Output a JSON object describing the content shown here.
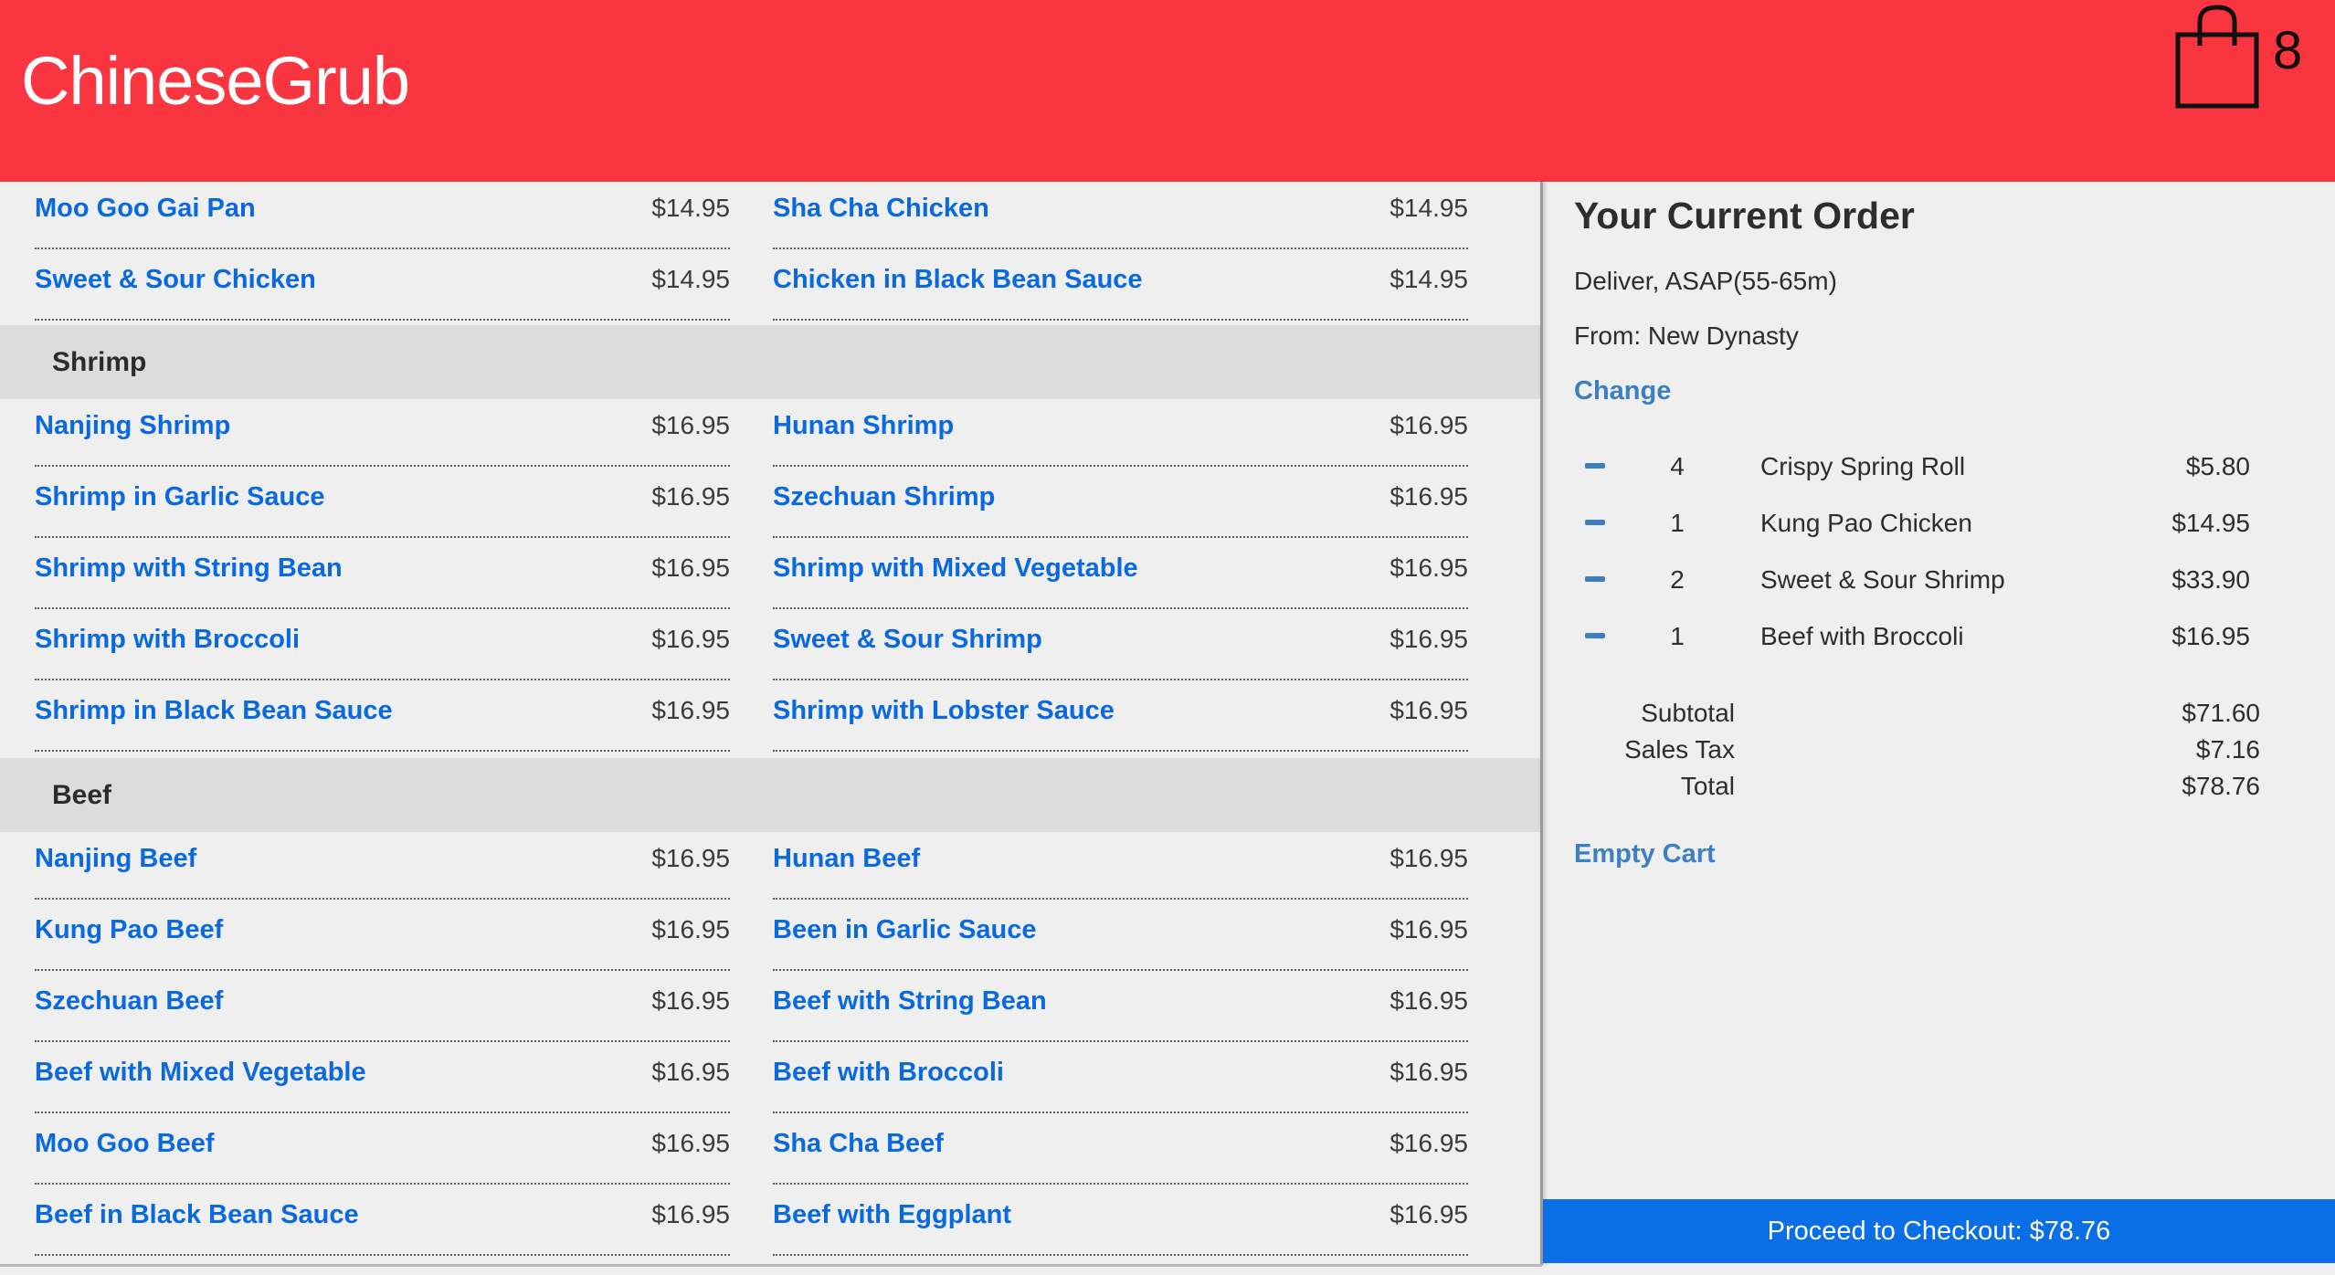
{
  "header": {
    "brand": "ChineseGrub",
    "cart_count": "8",
    "bg_color": "#f93540"
  },
  "menu": {
    "top_rows": [
      {
        "left": {
          "name": "Moo Goo Gai Pan",
          "price": "$14.95"
        },
        "right": {
          "name": "Sha Cha Chicken",
          "price": "$14.95"
        }
      },
      {
        "left": {
          "name": "Sweet & Sour Chicken",
          "price": "$14.95"
        },
        "right": {
          "name": "Chicken in Black Bean Sauce",
          "price": "$14.95"
        }
      }
    ],
    "categories": [
      {
        "label": "Shrimp",
        "rows": [
          {
            "left": {
              "name": "Nanjing Shrimp",
              "price": "$16.95"
            },
            "right": {
              "name": "Hunan Shrimp",
              "price": "$16.95"
            }
          },
          {
            "left": {
              "name": "Shrimp in Garlic Sauce",
              "price": "$16.95"
            },
            "right": {
              "name": "Szechuan Shrimp",
              "price": "$16.95"
            }
          },
          {
            "left": {
              "name": "Shrimp with String Bean",
              "price": "$16.95"
            },
            "right": {
              "name": "Shrimp with Mixed Vegetable",
              "price": "$16.95"
            }
          },
          {
            "left": {
              "name": "Shrimp with Broccoli",
              "price": "$16.95"
            },
            "right": {
              "name": "Sweet & Sour Shrimp",
              "price": "$16.95"
            }
          },
          {
            "left": {
              "name": "Shrimp in Black Bean Sauce",
              "price": "$16.95"
            },
            "right": {
              "name": "Shrimp with Lobster Sauce",
              "price": "$16.95"
            }
          }
        ]
      },
      {
        "label": "Beef",
        "rows": [
          {
            "left": {
              "name": "Nanjing Beef",
              "price": "$16.95"
            },
            "right": {
              "name": "Hunan Beef",
              "price": "$16.95"
            }
          },
          {
            "left": {
              "name": "Kung Pao Beef",
              "price": "$16.95"
            },
            "right": {
              "name": "Been in Garlic Sauce",
              "price": "$16.95"
            }
          },
          {
            "left": {
              "name": "Szechuan Beef",
              "price": "$16.95"
            },
            "right": {
              "name": "Beef with String Bean",
              "price": "$16.95"
            }
          },
          {
            "left": {
              "name": "Beef with Mixed Vegetable",
              "price": "$16.95"
            },
            "right": {
              "name": "Beef with Broccoli",
              "price": "$16.95"
            }
          },
          {
            "left": {
              "name": "Moo Goo Beef",
              "price": "$16.95"
            },
            "right": {
              "name": "Sha Cha Beef",
              "price": "$16.95"
            }
          },
          {
            "left": {
              "name": "Beef in Black Bean Sauce",
              "price": "$16.95"
            },
            "right": {
              "name": "Beef with Eggplant",
              "price": "$16.95"
            }
          }
        ]
      }
    ]
  },
  "order": {
    "title": "Your Current Order",
    "delivery": "Deliver, ASAP(55-65m)",
    "from": "From: New Dynasty",
    "change_label": "Change",
    "lines": [
      {
        "qty": "4",
        "name": "Crispy Spring Roll",
        "price": "$5.80"
      },
      {
        "qty": "1",
        "name": "Kung Pao Chicken",
        "price": "$14.95"
      },
      {
        "qty": "2",
        "name": "Sweet & Sour Shrimp",
        "price": "$33.90"
      },
      {
        "qty": "1",
        "name": "Beef with Broccoli",
        "price": "$16.95"
      }
    ],
    "subtotal_label": "Subtotal",
    "subtotal": "$71.60",
    "tax_label": "Sales Tax",
    "tax": "$7.16",
    "total_label": "Total",
    "total": "$78.76",
    "empty_cart_label": "Empty Cart",
    "checkout_label": "Proceed to Checkout: $78.76"
  },
  "colors": {
    "link": "#0a69df",
    "accent_link": "#3c7fc2",
    "checkout_bg": "#0a6fe6"
  }
}
